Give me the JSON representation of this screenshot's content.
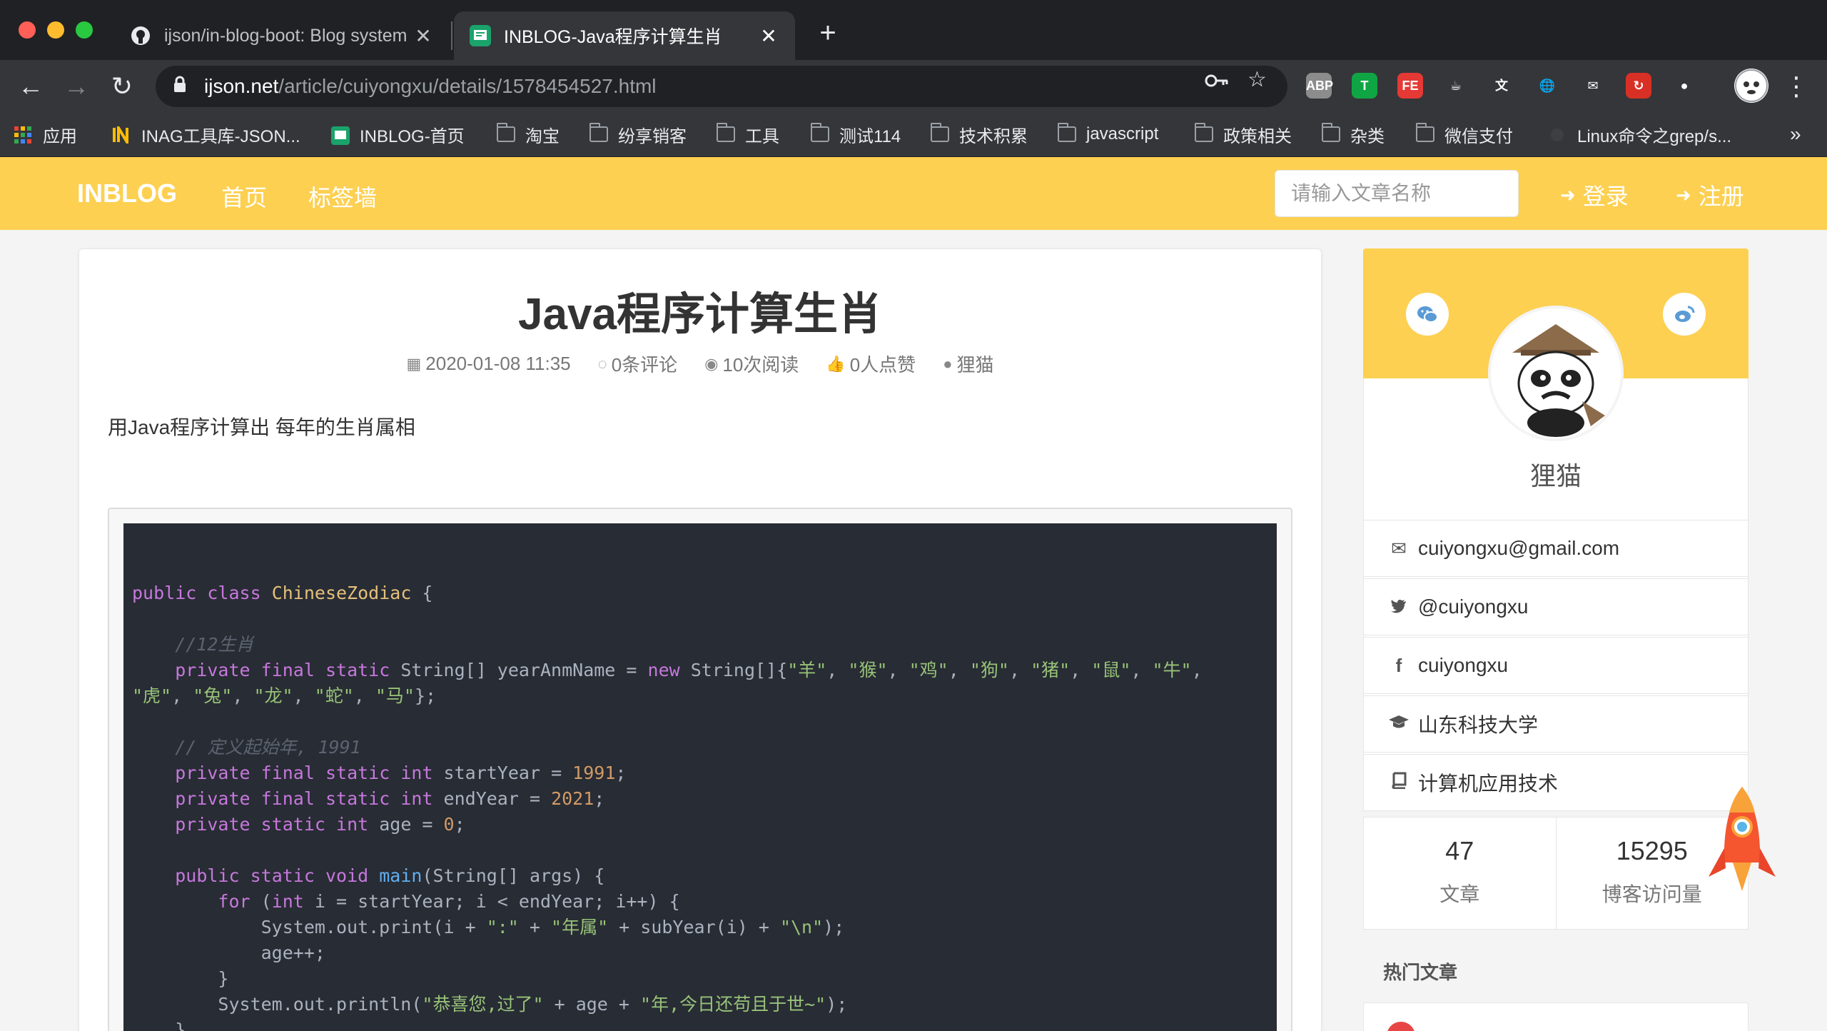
{
  "browser": {
    "tabs": [
      {
        "title": "ijson/in-blog-boot: Blog system",
        "active": false,
        "favicon": "github-icon"
      },
      {
        "title": "INBLOG-Java程序计算生肖",
        "active": true,
        "favicon": "inblog-icon"
      }
    ],
    "url": {
      "host": "ijson.net",
      "path": "/article/cuiyongxu/details/1578454527.html"
    },
    "bookmarks": [
      {
        "label": "应用",
        "icon": "apps-grid-icon"
      },
      {
        "label": "INAG工具库-JSON...",
        "icon": "inag-icon"
      },
      {
        "label": "INBLOG-首页",
        "icon": "inblog-icon"
      },
      {
        "label": "淘宝",
        "icon": "folder-icon"
      },
      {
        "label": "纷享销客",
        "icon": "folder-icon"
      },
      {
        "label": "工具",
        "icon": "folder-icon"
      },
      {
        "label": "测试114",
        "icon": "folder-icon"
      },
      {
        "label": "技术积累",
        "icon": "folder-icon"
      },
      {
        "label": "javascript",
        "icon": "folder-icon"
      },
      {
        "label": "政策相关",
        "icon": "folder-icon"
      },
      {
        "label": "杂类",
        "icon": "folder-icon"
      },
      {
        "label": "微信支付",
        "icon": "folder-icon"
      },
      {
        "label": "Linux命令之grep/s...",
        "icon": "page-icon"
      }
    ],
    "bookmarks_overflow": "»",
    "extensions": [
      {
        "name": "abp-icon",
        "text": "ABP",
        "color": "#8c8c8c"
      },
      {
        "name": "tampermonkey-icon",
        "text": "T",
        "color": "#10a544"
      },
      {
        "name": "fe-helper-icon",
        "text": "FE",
        "color": "#e53935"
      },
      {
        "name": "java-icon",
        "text": "☕",
        "color": "#35363a"
      },
      {
        "name": "translate-icon",
        "text": "文",
        "color": "#35363a"
      },
      {
        "name": "globe-icon",
        "text": "🌐",
        "color": "#35363a"
      },
      {
        "name": "mail-icon",
        "text": "✉",
        "color": "#35363a"
      },
      {
        "name": "sync-icon",
        "text": "↻",
        "color": "#d93025"
      },
      {
        "name": "colorful-ball-icon",
        "text": "●",
        "color": "#35363a"
      }
    ]
  },
  "site": {
    "brand": "INBLOG",
    "nav": [
      "首页",
      "标签墙"
    ],
    "search_placeholder": "请输入文章名称",
    "login": "登录",
    "register": "注册",
    "accent_color": "#fdd052"
  },
  "article": {
    "title": "Java程序计算生肖",
    "meta": {
      "date": "2020-01-08 11:35",
      "comments": "0条评论",
      "views": "10次阅读",
      "likes": "0人点赞",
      "author": "狸猫"
    },
    "summary": "用Java程序计算出 每年的生肖属相",
    "code_lines": [
      "",
      "public class ChineseZodiac {",
      "",
      "    //12生肖",
      "    private final static String[] yearAnmName = new String[]{\"羊\", \"猴\", \"鸡\", \"狗\", \"猪\", \"鼠\", \"牛\",",
      "\"虎\", \"兔\", \"龙\", \"蛇\", \"马\"};",
      "",
      "    // 定义起始年, 1991",
      "    private final static int startYear = 1991;",
      "    private final static int endYear = 2021;",
      "    private static int age = 0;",
      "",
      "    public static void main(String[] args) {",
      "        for (int i = startYear; i < endYear; i++) {",
      "            System.out.print(i + \":\" + \"年属\" + subYear(i) + \"\\n\");",
      "            age++;",
      "        }",
      "        System.out.println(\"恭喜您,过了\" + age + \"年,今日还苟且于世~\");",
      "    }"
    ]
  },
  "profile": {
    "name": "狸猫",
    "email": "cuiyongxu@gmail.com",
    "twitter": "@cuiyongxu",
    "facebook": "cuiyongxu",
    "school": "山东科技大学",
    "major": "计算机应用技术",
    "stats": [
      {
        "value": "47",
        "label": "文章"
      },
      {
        "value": "15295",
        "label": "博客访问量"
      }
    ]
  },
  "hot": {
    "title": "热门文章"
  }
}
